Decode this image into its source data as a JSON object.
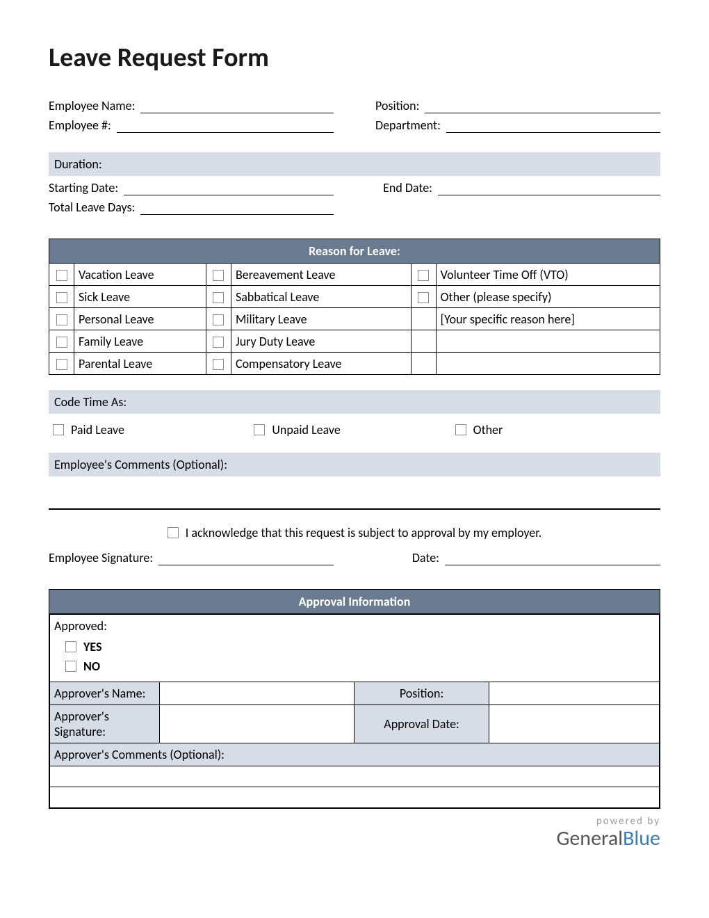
{
  "title": "Leave Request Form",
  "employee": {
    "name_label": "Employee Name:",
    "number_label": "Employee #:",
    "position_label": "Position:",
    "department_label": "Department:"
  },
  "duration": {
    "header": "Duration:",
    "start_label": "Starting Date:",
    "end_label": "End Date:",
    "total_label": "Total Leave Days:"
  },
  "reason": {
    "header": "Reason for Leave:",
    "col1": [
      "Vacation Leave",
      "Sick Leave",
      "Personal Leave",
      "Family Leave",
      "Parental Leave"
    ],
    "col2": [
      "Bereavement Leave",
      "Sabbatical Leave",
      "Military Leave",
      "Jury Duty Leave",
      "Compensatory Leave"
    ],
    "col3": [
      "Volunteer Time Off (VTO)",
      "Other (please specify)",
      "[Your specific reason here]",
      "",
      ""
    ]
  },
  "code_time": {
    "header": "Code Time As:",
    "opts": [
      "Paid Leave",
      "Unpaid Leave",
      "Other"
    ]
  },
  "comments": {
    "header": "Employee's Comments (Optional):"
  },
  "ack": {
    "text": "I acknowledge that this request is subject to approval by my employer."
  },
  "signature": {
    "sig_label": "Employee Signature:",
    "date_label": "Date:"
  },
  "approval": {
    "header": "Approval Information",
    "approved_label": "Approved:",
    "yes": "YES",
    "no": "NO",
    "name_label": "Approver's Name:",
    "position_label": "Position:",
    "sig_label": "Approver's Signature:",
    "date_label": "Approval Date:",
    "comments_label": "Approver's Comments (Optional):"
  },
  "footer": {
    "powered": "powered by",
    "brand1": "General",
    "brand2": "Blue"
  }
}
